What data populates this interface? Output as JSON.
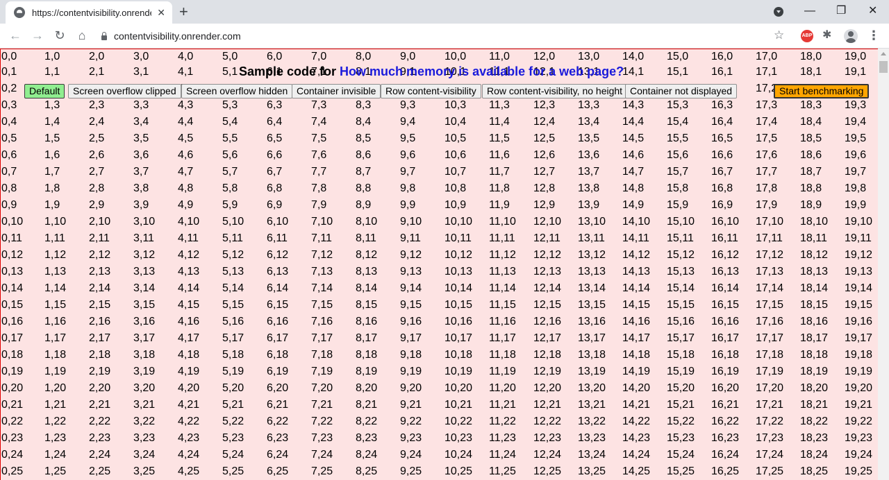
{
  "browser": {
    "tab_title": "https://contentvisibility.onrender",
    "close_glyph": "✕",
    "new_tab_glyph": "+",
    "url": "contentvisibility.onrender.com",
    "win_minimize": "—",
    "win_restore": "❐",
    "win_close": "✕",
    "back_glyph": "←",
    "forward_glyph": "→",
    "reload_glyph": "↻",
    "home_glyph": "⌂",
    "star_glyph": "☆",
    "abp_label": "ABP",
    "puzzle_glyph": "✱",
    "kebab_glyph": "⋮"
  },
  "heading": {
    "prefix": "Sample code for ",
    "link_text": "How much memory is available for a web page?"
  },
  "controls": {
    "buttons": [
      {
        "label": "Default",
        "active": true
      },
      {
        "label": "Screen overflow clipped",
        "active": false
      },
      {
        "label": "Screen overflow hidden",
        "active": false
      },
      {
        "label": "Container invisible",
        "active": false
      },
      {
        "label": "Row content-visibility",
        "active": false
      },
      {
        "label": "Row content-visibility, no height",
        "active": false
      },
      {
        "label": "Container not displayed",
        "active": false
      }
    ],
    "start_label": "Start benchmarking"
  },
  "grid": {
    "columns": 20,
    "rows_visible": 26,
    "cell_format": "{col},{row}"
  },
  "colors": {
    "cell_fill": "#fde3e3",
    "cell_border": "#e00000",
    "link": "#1a1adb",
    "active_button": "#90ee90",
    "start_button": "#ffa500"
  }
}
